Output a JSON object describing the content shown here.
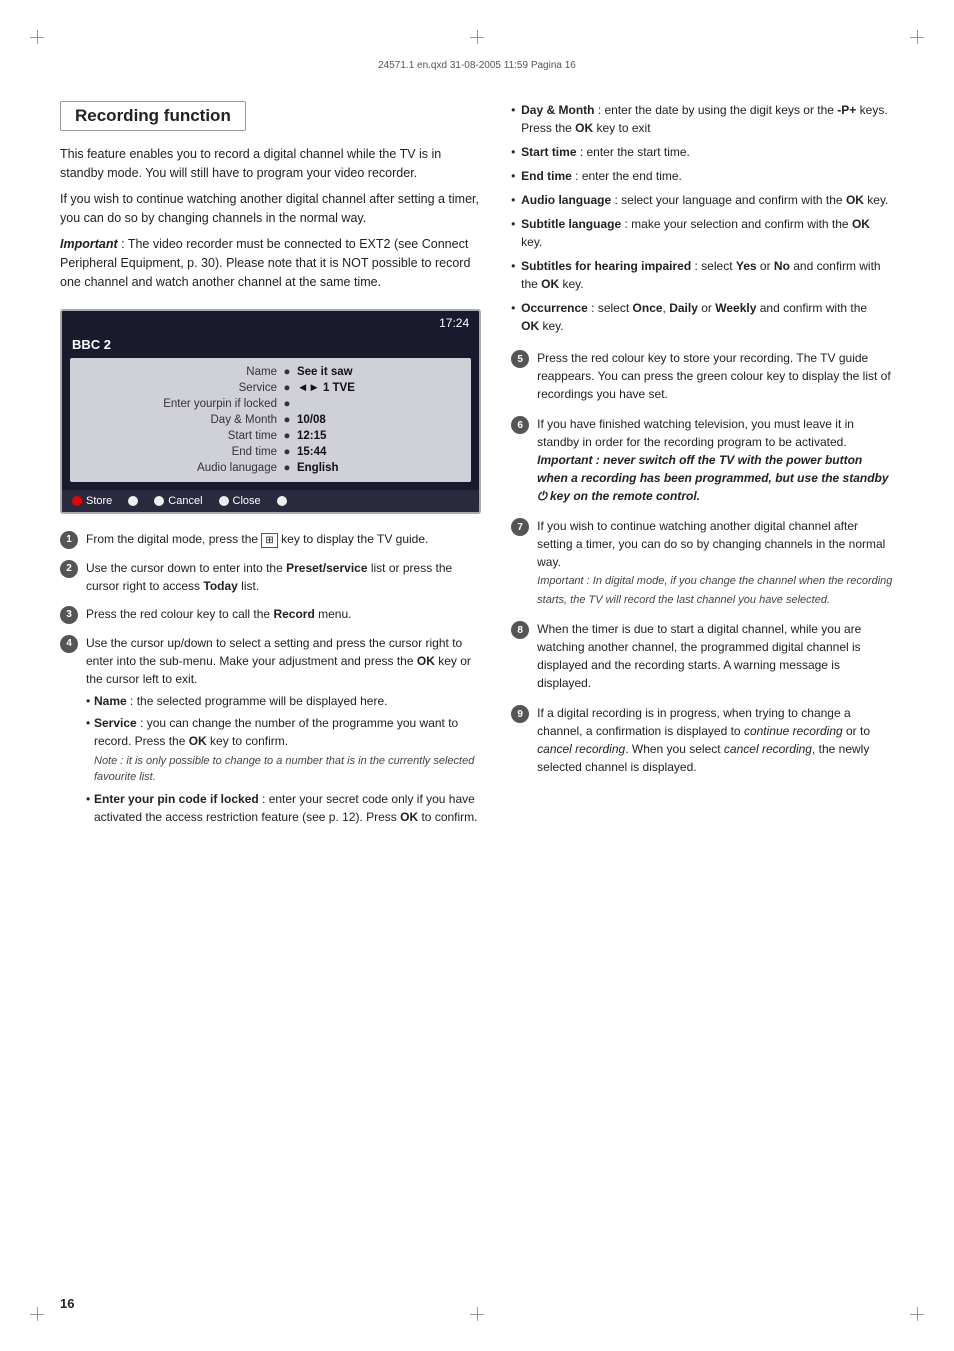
{
  "meta": {
    "line": "24571.1 en.qxd   31-08-2005   11:59   Pagina 16"
  },
  "section": {
    "title": "Recording function"
  },
  "intro": {
    "para1": "This feature enables you to record a digital channel while the TV is in standby mode. You will still have to program your video recorder.",
    "para2": "If you wish to continue watching another digital channel after setting a timer, you can do so by changing channels in the normal way.",
    "para3_label": "Important",
    "para3": " : The video recorder must be connected to EXT2 (see Connect Peripheral Equipment, p. 30). Please note that it is NOT possible to record one channel and watch another channel at the same time."
  },
  "tv_screen": {
    "time": "17:24",
    "channel": "BBC 2",
    "rows": [
      {
        "label": "Name",
        "dot": "●",
        "value": "See it saw"
      },
      {
        "label": "Service",
        "dot": "●",
        "value": "1 TVE",
        "has_icon": true
      },
      {
        "label": "Enter yourpin if locked",
        "dot": "●",
        "value": ""
      },
      {
        "label": "Day & Month",
        "dot": "●",
        "value": "10/08"
      },
      {
        "label": "Start time",
        "dot": "●",
        "value": "12:15"
      },
      {
        "label": "End time",
        "dot": "●",
        "value": "15:44"
      },
      {
        "label": "Audio lanugage",
        "dot": "●",
        "value": "English"
      }
    ],
    "buttons": [
      {
        "color": "red",
        "label": "Store"
      },
      {
        "color": "white",
        "label": ""
      },
      {
        "color": "white",
        "label": "Cancel"
      },
      {
        "color": "white",
        "label": "Close"
      },
      {
        "color": "white",
        "label": ""
      }
    ]
  },
  "left_steps": [
    {
      "num": "1",
      "text": "From the digital mode, press the",
      "bold_part": "key to display the TV guide.",
      "icon": "⊞"
    },
    {
      "num": "2",
      "text": "Use the cursor down to enter into the ",
      "bold": "Preset/service",
      "text2": " list or press the cursor right to access ",
      "bold2": "Today",
      "text3": " list."
    },
    {
      "num": "3",
      "text": "Press the red colour key to call the ",
      "bold": "Record",
      "text2": " menu."
    },
    {
      "num": "4",
      "text": "Use the cursor up/down to select a setting and press the cursor right to enter into the sub-menu. Make your adjustment and press the ",
      "bold": "OK",
      "text2": " key or the cursor left to exit.",
      "bullets": [
        {
          "label": "Name",
          "text": " : the selected programme will be displayed here."
        },
        {
          "label": "Service",
          "text": " : you can change the number of the programme you want to record. Press the ",
          "bold": "OK",
          "text2": " key to confirm.",
          "note": "Note : it is only possible to change to a number that is in the currently selected favourite list."
        },
        {
          "label": "Enter your pin code if locked",
          "text": " : enter your secret code only if you have activated the access restriction feature (see p. 12). Press ",
          "bold": "OK",
          "text2": " to confirm."
        }
      ]
    }
  ],
  "right_bullets": [
    {
      "label": "Day & Month",
      "text": " : enter the date by using the digit keys or the ",
      "bold": "-P+",
      "text2": " keys. Press the ",
      "bold2": "OK",
      "text3": " key to exit"
    },
    {
      "label": "Start time",
      "text": " : enter the start time."
    },
    {
      "label": "End time",
      "text": " : enter the end time."
    },
    {
      "label": "Audio language",
      "text": " : select your language and confirm with the ",
      "bold": "OK",
      "text2": " key."
    },
    {
      "label": "Subtitle language",
      "text": " : make your selection and confirm with the ",
      "bold": "OK",
      "text2": " key."
    },
    {
      "label": "Subtitles for hearing impaired",
      "text": " : select ",
      "bold": "Yes",
      "text2": " or ",
      "bold2": "No",
      "text3": " and confirm with the ",
      "bold3": "OK",
      "text4": " key."
    },
    {
      "label": "Occurrence",
      "text": " : select ",
      "bold": "Once",
      "text2": ", ",
      "bold2": "Daily",
      "text3": " or ",
      "bold3": "Weekly",
      "text4": " and confirm with the ",
      "bold4": "OK",
      "text5": " key."
    }
  ],
  "right_steps": [
    {
      "num": "5",
      "text": "Press the red colour key to store your recording. The TV guide reappears. You can press the green colour key to display the list of recordings you have set."
    },
    {
      "num": "6",
      "text": "If you have finished watching television, you must leave it in standby in order for the recording program to be activated.",
      "bold_italic": "Important : never switch off the TV with the power button when a recording has been programmed, but use the standby",
      "icon": "⏻",
      "bold_italic2": "key on the remote control."
    },
    {
      "num": "7",
      "text": "If you wish to continue watching another digital channel after setting a timer, you can do so by changing channels in the normal way.",
      "note": "Important : In digital mode, if you change the channel when the recording starts, the TV will record the last channel you have selected."
    },
    {
      "num": "8",
      "text": "When the timer is due to start a digital channel, while you are watching another channel, the programmed digital channel is displayed and the recording starts. A warning message is displayed."
    },
    {
      "num": "9",
      "text": "If a digital recording is in progress, when trying to change a channel, a confirmation is displayed to ",
      "italic": "continue recording",
      "text2": " or to ",
      "italic2": "cancel recording",
      "text3": ". When you select ",
      "italic3": "cancel recording",
      "text4": ", the newly selected channel is displayed."
    }
  ],
  "page_number": "16"
}
